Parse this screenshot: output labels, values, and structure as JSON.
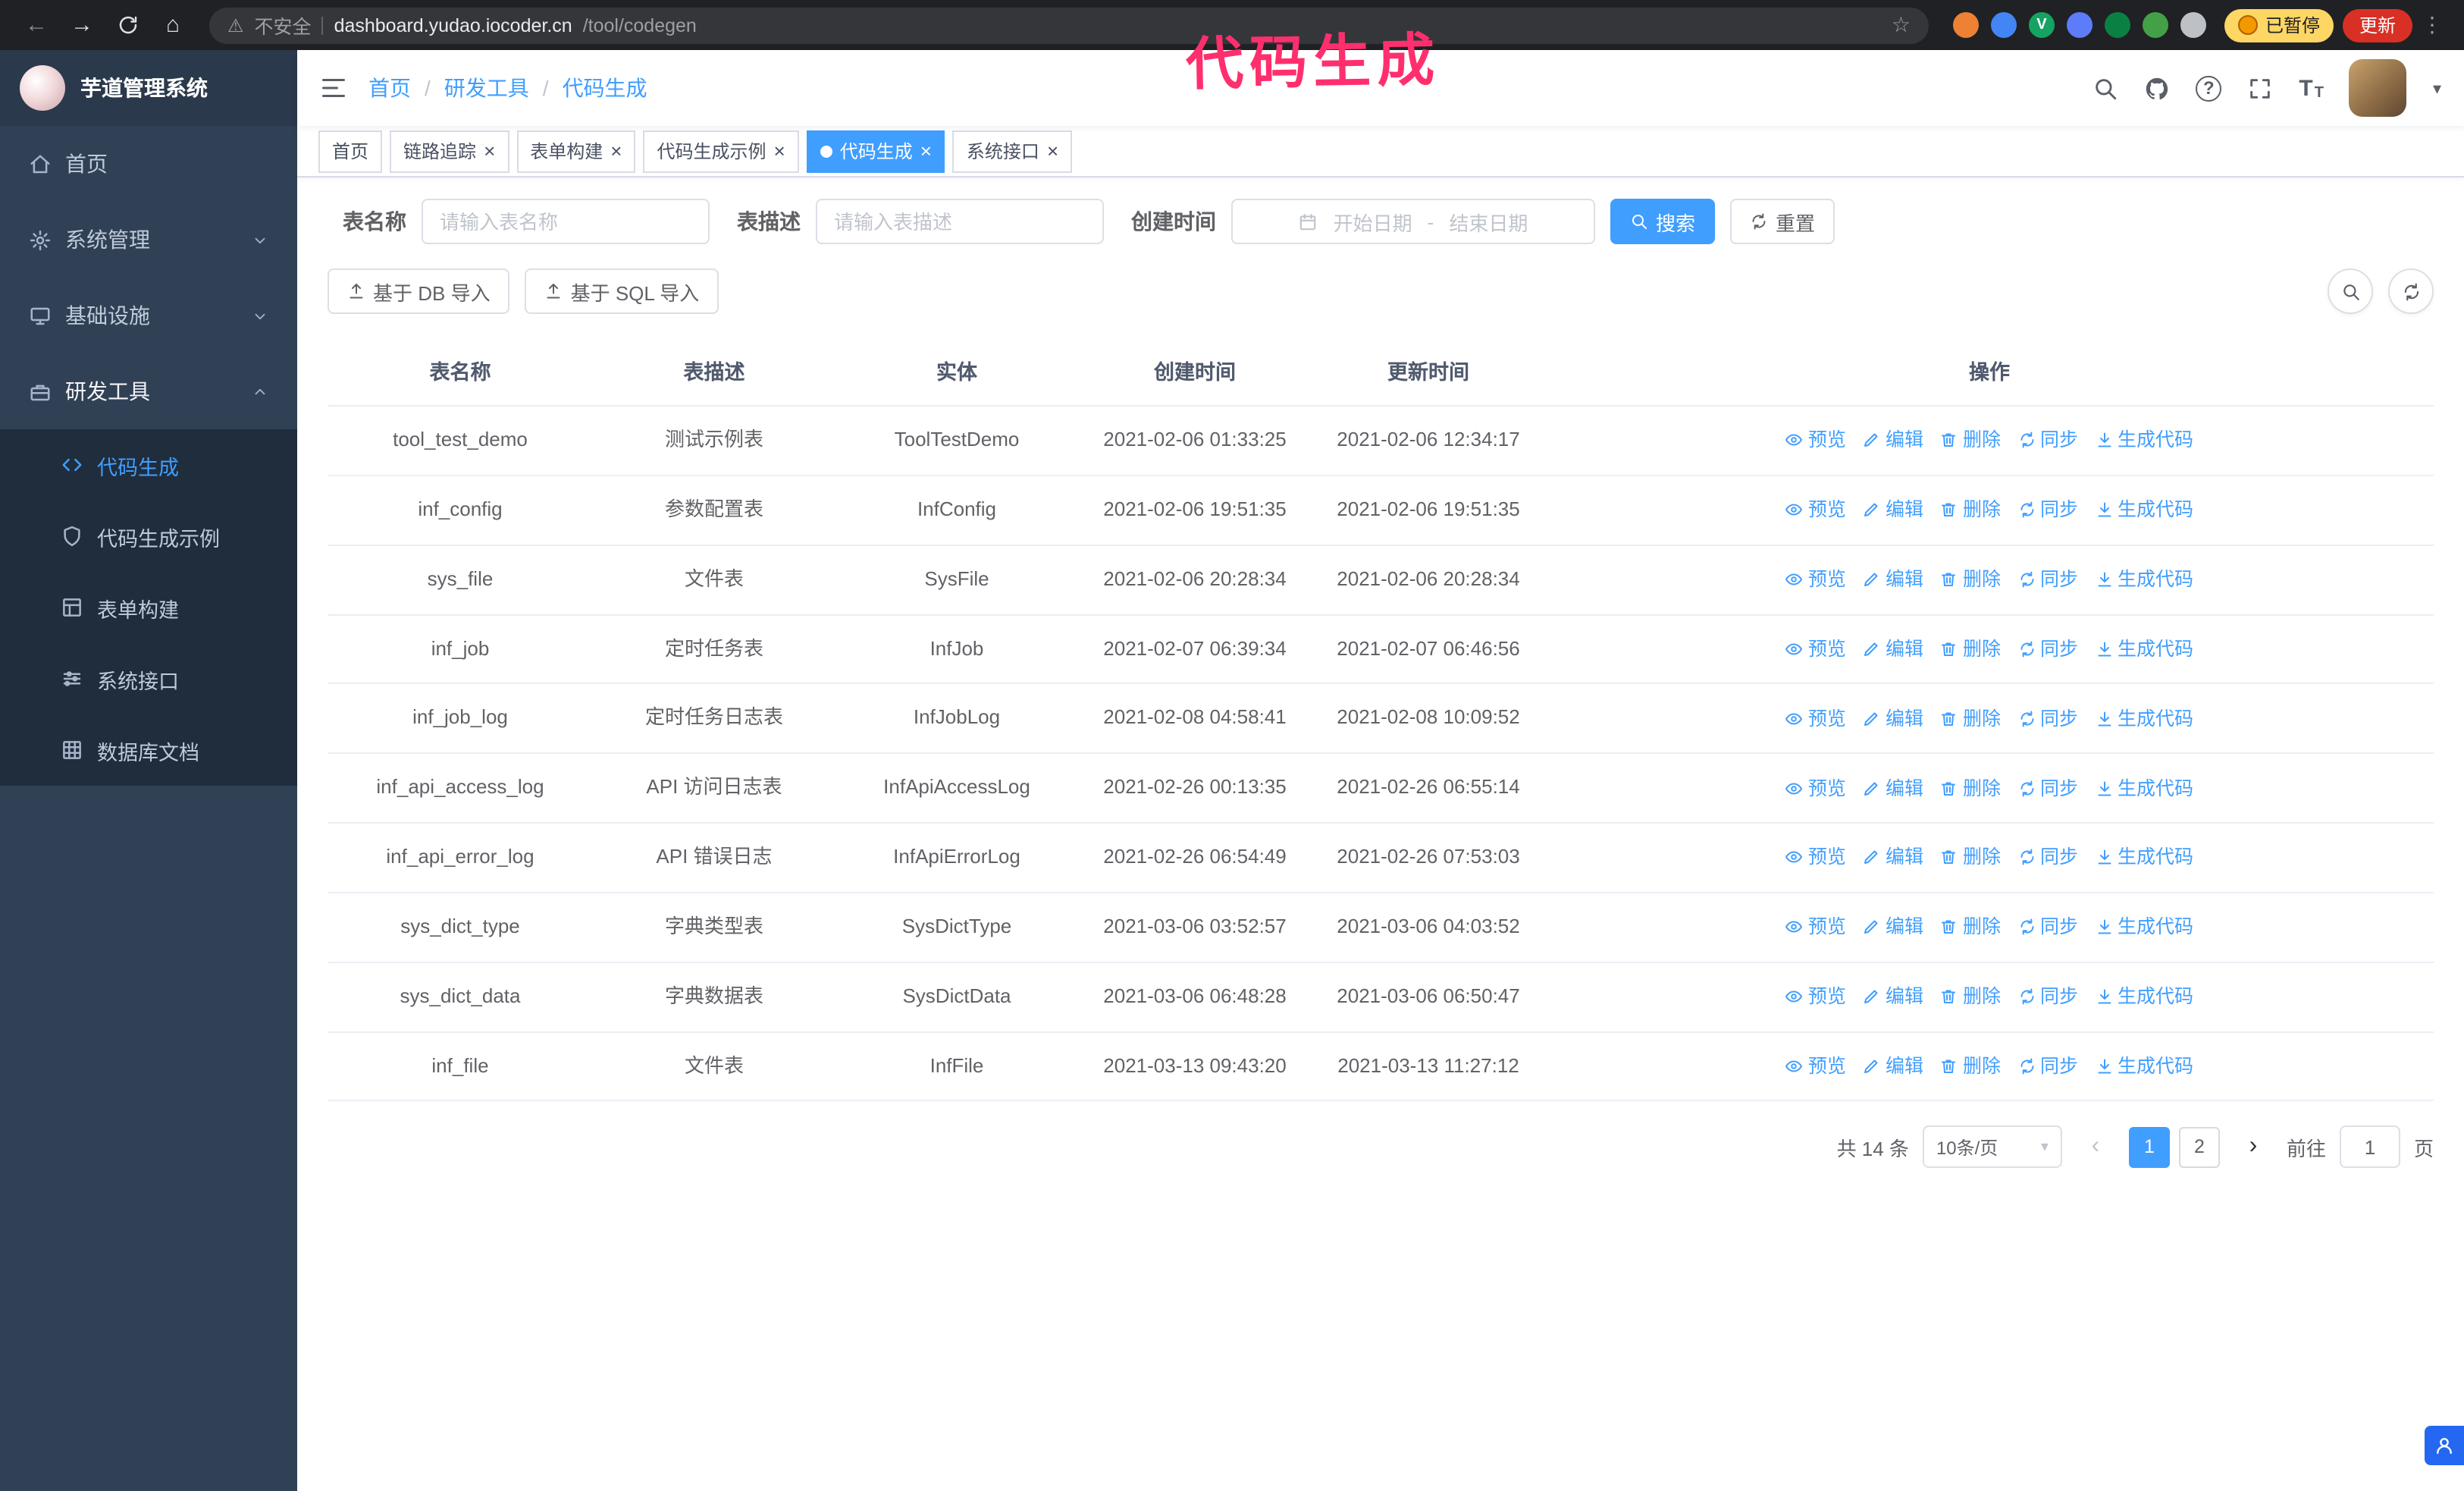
{
  "theme": {
    "accent": "#409eff",
    "sidebar_bg": "#304156",
    "submenu_bg": "#1f2d3d",
    "annotation_color": "#ff2f6e",
    "update_button_color": "#d93025",
    "paused_badge_color": "#fdd663"
  },
  "browser": {
    "security_label": "不安全",
    "url_host": "dashboard.yudao.iocoder.cn",
    "url_path": "/tool/codegen",
    "paused_badge": "已暂停",
    "update_button": "更新",
    "extensions": [
      {
        "name": "extension-icon-orange",
        "color": "#ee8133",
        "glyph": ""
      },
      {
        "name": "extension-icon-blue",
        "color": "#4285f4",
        "glyph": ""
      },
      {
        "name": "extension-icon-green-v",
        "color": "#15a362",
        "glyph": "V"
      },
      {
        "name": "extension-icon-people",
        "color": "#5c7cfa",
        "glyph": ""
      },
      {
        "name": "extension-icon-teal",
        "color": "#0b8043",
        "glyph": ""
      },
      {
        "name": "extension-icon-leaf",
        "color": "#43a047",
        "glyph": ""
      },
      {
        "name": "extension-icon-puzzle",
        "color": "#bdc1c6",
        "glyph": ""
      }
    ]
  },
  "annotation": {
    "text": "代码生成"
  },
  "sidebar": {
    "logo_title": "芋道管理系统",
    "items": [
      {
        "label": "首页",
        "icon": "home-icon",
        "type": "item",
        "state": "none"
      },
      {
        "label": "系统管理",
        "icon": "gear-icon",
        "type": "group",
        "state": "collapsed"
      },
      {
        "label": "基础设施",
        "icon": "monitor-icon",
        "type": "group",
        "state": "collapsed"
      },
      {
        "label": "研发工具",
        "icon": "toolbox-icon",
        "type": "group",
        "state": "expanded"
      }
    ],
    "subitems": [
      {
        "label": "代码生成",
        "icon": "code-icon",
        "active": true
      },
      {
        "label": "代码生成示例",
        "icon": "shield-icon",
        "active": false
      },
      {
        "label": "表单构建",
        "icon": "form-grid-icon",
        "active": false
      },
      {
        "label": "系统接口",
        "icon": "sliders-icon",
        "active": false
      },
      {
        "label": "数据库文档",
        "icon": "table-grid-icon",
        "active": false
      }
    ]
  },
  "breadcrumb": {
    "items": [
      "首页",
      "研发工具",
      "代码生成"
    ],
    "separator": "/"
  },
  "navbar": {
    "help_glyph": "?",
    "font_icon_large": "T",
    "font_icon_small": "T"
  },
  "tabs": [
    {
      "label": "首页",
      "closable": false,
      "active": false
    },
    {
      "label": "链路追踪",
      "closable": true,
      "active": false
    },
    {
      "label": "表单构建",
      "closable": true,
      "active": false
    },
    {
      "label": "代码生成示例",
      "closable": true,
      "active": false
    },
    {
      "label": "代码生成",
      "closable": true,
      "active": true
    },
    {
      "label": "系统接口",
      "closable": true,
      "active": false
    }
  ],
  "filters": {
    "table_name_label": "表名称",
    "table_name_placeholder": "请输入表名称",
    "table_desc_label": "表描述",
    "table_desc_placeholder": "请输入表描述",
    "create_time_label": "创建时间",
    "date_start_placeholder": "开始日期",
    "date_separator": "-",
    "date_end_placeholder": "结束日期",
    "search_button": "搜索",
    "reset_button": "重置"
  },
  "toolbar": {
    "import_db_button": "基于 DB 导入",
    "import_sql_button": "基于 SQL 导入"
  },
  "table": {
    "columns": [
      "表名称",
      "表描述",
      "实体",
      "创建时间",
      "更新时间",
      "操作"
    ],
    "actions": [
      {
        "label": "预览",
        "icon": "eye-icon",
        "name": "preview-link"
      },
      {
        "label": "编辑",
        "icon": "edit-icon",
        "name": "edit-link"
      },
      {
        "label": "删除",
        "icon": "delete-icon",
        "name": "delete-link"
      },
      {
        "label": "同步",
        "icon": "refresh-icon",
        "name": "sync-link"
      },
      {
        "label": "生成代码",
        "icon": "download-icon",
        "name": "generate-code-link"
      }
    ],
    "rows": [
      {
        "name": "tool_test_demo",
        "desc": "测试示例表",
        "entity": "ToolTestDemo",
        "created": "2021-02-06 01:33:25",
        "updated": "2021-02-06 12:34:17"
      },
      {
        "name": "inf_config",
        "desc": "参数配置表",
        "entity": "InfConfig",
        "created": "2021-02-06 19:51:35",
        "updated": "2021-02-06 19:51:35"
      },
      {
        "name": "sys_file",
        "desc": "文件表",
        "entity": "SysFile",
        "created": "2021-02-06 20:28:34",
        "updated": "2021-02-06 20:28:34"
      },
      {
        "name": "inf_job",
        "desc": "定时任务表",
        "entity": "InfJob",
        "created": "2021-02-07 06:39:34",
        "updated": "2021-02-07 06:46:56"
      },
      {
        "name": "inf_job_log",
        "desc": "定时任务日志表",
        "entity": "InfJobLog",
        "created": "2021-02-08 04:58:41",
        "updated": "2021-02-08 10:09:52"
      },
      {
        "name": "inf_api_access_log",
        "desc": "API 访问日志表",
        "entity": "InfApiAccessLog",
        "created": "2021-02-26 00:13:35",
        "updated": "2021-02-26 06:55:14"
      },
      {
        "name": "inf_api_error_log",
        "desc": "API 错误日志",
        "entity": "InfApiErrorLog",
        "created": "2021-02-26 06:54:49",
        "updated": "2021-02-26 07:53:03"
      },
      {
        "name": "sys_dict_type",
        "desc": "字典类型表",
        "entity": "SysDictType",
        "created": "2021-03-06 03:52:57",
        "updated": "2021-03-06 04:03:52"
      },
      {
        "name": "sys_dict_data",
        "desc": "字典数据表",
        "entity": "SysDictData",
        "created": "2021-03-06 06:48:28",
        "updated": "2021-03-06 06:50:47"
      },
      {
        "name": "inf_file",
        "desc": "文件表",
        "entity": "InfFile",
        "created": "2021-03-13 09:43:20",
        "updated": "2021-03-13 11:27:12"
      }
    ]
  },
  "pagination": {
    "total_text": "共 14 条",
    "page_size": "10条/页",
    "pages": [
      "1",
      "2"
    ],
    "active_page": "1",
    "goto_label": "前往",
    "goto_value": "1",
    "goto_suffix": "页"
  }
}
